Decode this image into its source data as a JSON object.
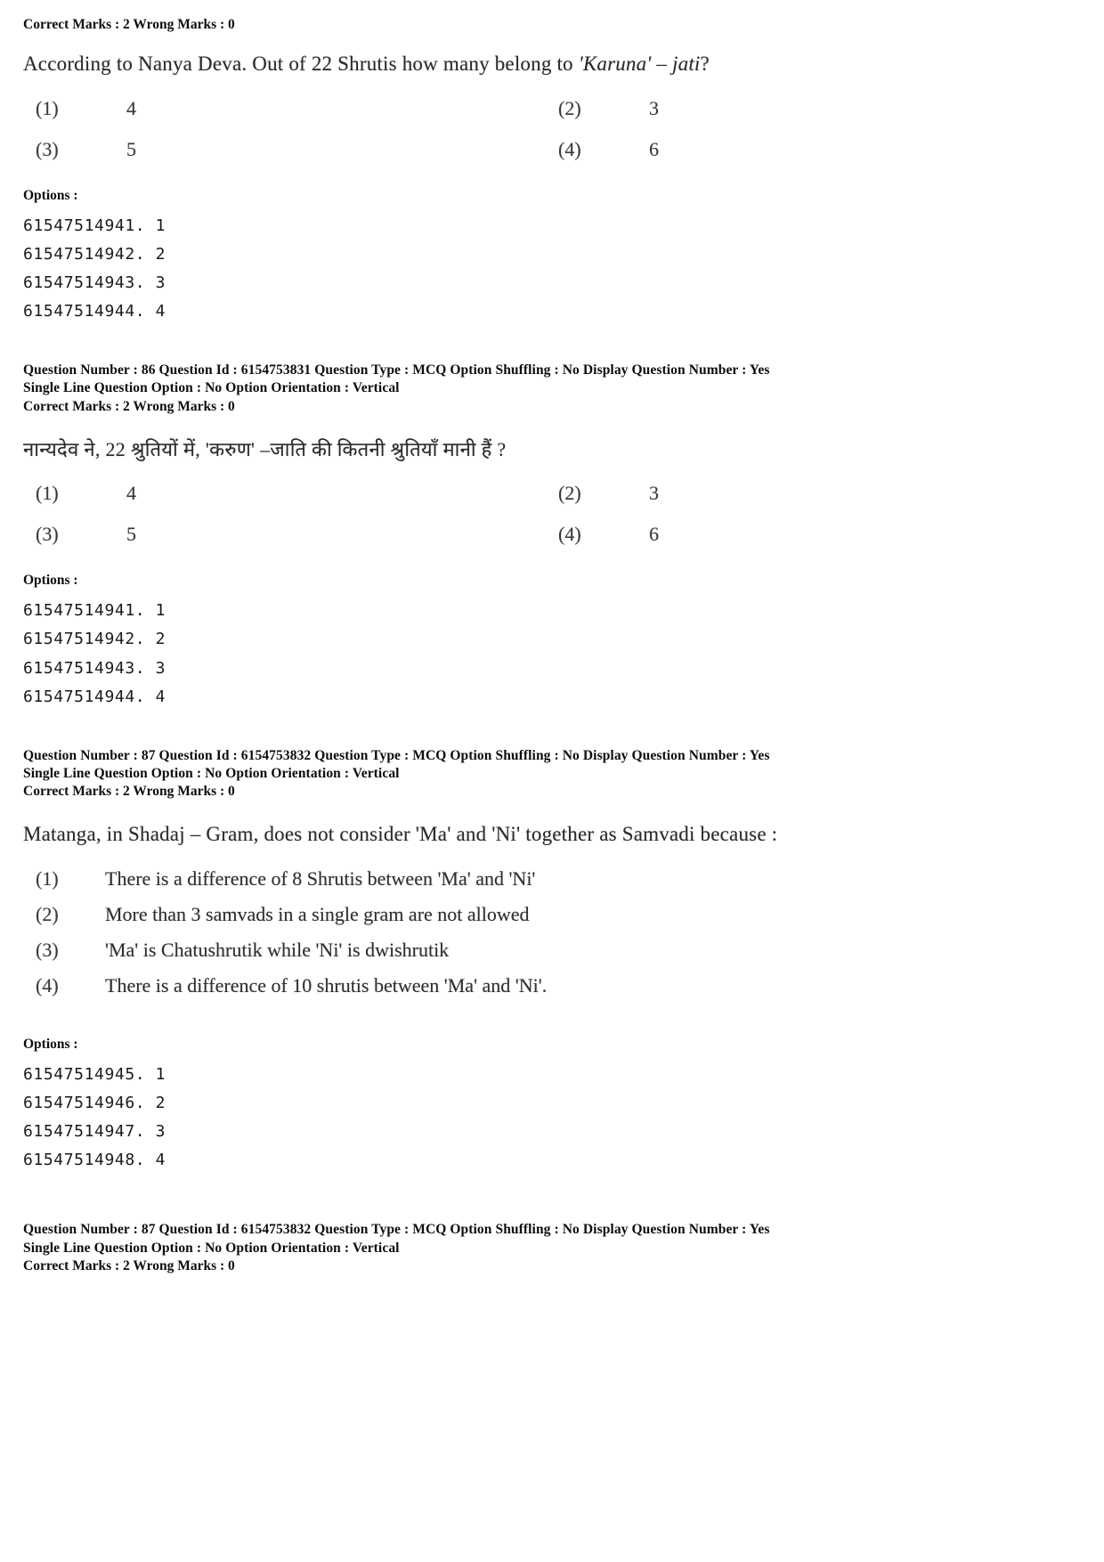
{
  "labels": {
    "options_heading": "Options :"
  },
  "blocks": [
    {
      "id": "q86-english",
      "marks_line": "Correct Marks : 2  Wrong Marks : 0",
      "question_text_parts": {
        "lead": "According to Nanya Deva. Out of 22 Shrutis how many belong to ",
        "italic": "'Karuna' – jati",
        "tail": "?"
      },
      "choice_labels": [
        "(1)",
        "(2)",
        "(3)",
        "(4)"
      ],
      "choice_values": [
        "4",
        "3",
        "5",
        "6"
      ],
      "option_ids": [
        "61547514941. 1",
        "61547514942. 2",
        "61547514943. 3",
        "61547514944. 4"
      ]
    },
    {
      "id": "q86-meta",
      "meta_line_1": "Question Number : 86  Question Id : 6154753831  Question Type : MCQ  Option Shuffling : No  Display Question Number : Yes",
      "meta_line_2": "Single Line Question Option : No  Option Orientation : Vertical",
      "marks_line": "Correct Marks : 2  Wrong Marks : 0"
    },
    {
      "id": "q86-hindi",
      "question_text": "नान्यदेव ने,  22  श्रुतियों में,  'करुण' –जाति की  कितनी  श्रुतियाँ मानी हैं ?",
      "choice_labels": [
        "(1)",
        "(2)",
        "(3)",
        "(4)"
      ],
      "choice_values": [
        "4",
        "3",
        "5",
        "6"
      ],
      "option_ids": [
        "61547514941. 1",
        "61547514942. 2",
        "61547514943. 3",
        "61547514944. 4"
      ]
    },
    {
      "id": "q87-meta-top",
      "meta_line_1": "Question Number : 87  Question Id : 6154753832  Question Type : MCQ  Option Shuffling : No  Display Question Number : Yes",
      "meta_line_2": "Single Line Question Option : No  Option Orientation : Vertical",
      "marks_line": "Correct Marks : 2  Wrong Marks : 0"
    },
    {
      "id": "q87-english",
      "question_text": "Matanga, in Shadaj – Gram, does not consider 'Ma' and 'Ni' together as Samvadi because :",
      "choice_labels": [
        "(1)",
        "(2)",
        "(3)",
        "(4)"
      ],
      "choice_texts": [
        "There is a difference of 8 Shrutis between 'Ma' and 'Ni'",
        "More than 3 samvads in a single gram are not allowed",
        "'Ma' is  Chatushrutik while 'Ni' is dwishrutik",
        "There is a difference of 10 shrutis between 'Ma' and 'Ni'."
      ],
      "option_ids": [
        "61547514945. 1",
        "61547514946. 2",
        "61547514947. 3",
        "61547514948. 4"
      ]
    },
    {
      "id": "q87-meta-bottom",
      "meta_line_1": "Question Number : 87  Question Id : 6154753832  Question Type : MCQ  Option Shuffling : No  Display Question Number : Yes",
      "meta_line_2": "Single Line Question Option : No  Option Orientation : Vertical",
      "marks_line": "Correct Marks : 2  Wrong Marks : 0"
    }
  ]
}
